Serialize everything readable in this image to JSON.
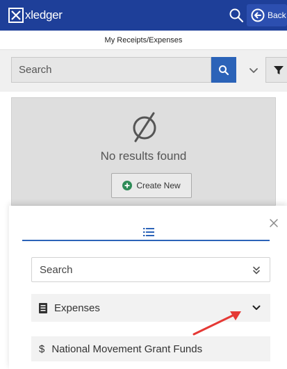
{
  "header": {
    "logo_text": "xledger",
    "back_label": "Back",
    "brand_color": "#1e3f99"
  },
  "page_title": "My Receipts/Expenses",
  "search": {
    "placeholder": "Search"
  },
  "results": {
    "empty_message": "No results found",
    "create_label": "Create New"
  },
  "sheet": {
    "search_placeholder": "Search",
    "groups": [
      {
        "icon": "document-list-icon",
        "label": "Expenses",
        "expanded": false
      },
      {
        "icon": "dollar-icon",
        "label": "National Movement Grant Funds"
      }
    ],
    "accent_color": "#2b63b8"
  },
  "icons": {
    "top": [
      "search-icon",
      "back-arrow-icon"
    ],
    "toolbar": [
      "search-icon",
      "chevron-down-icon",
      "filter-icon"
    ],
    "empty": "empty-set-icon",
    "create": "plus-circle-icon",
    "sheet": [
      "close-icon",
      "list-icon",
      "double-chevron-down-icon",
      "chevron-down-icon",
      "annotation-arrow-icon"
    ]
  }
}
